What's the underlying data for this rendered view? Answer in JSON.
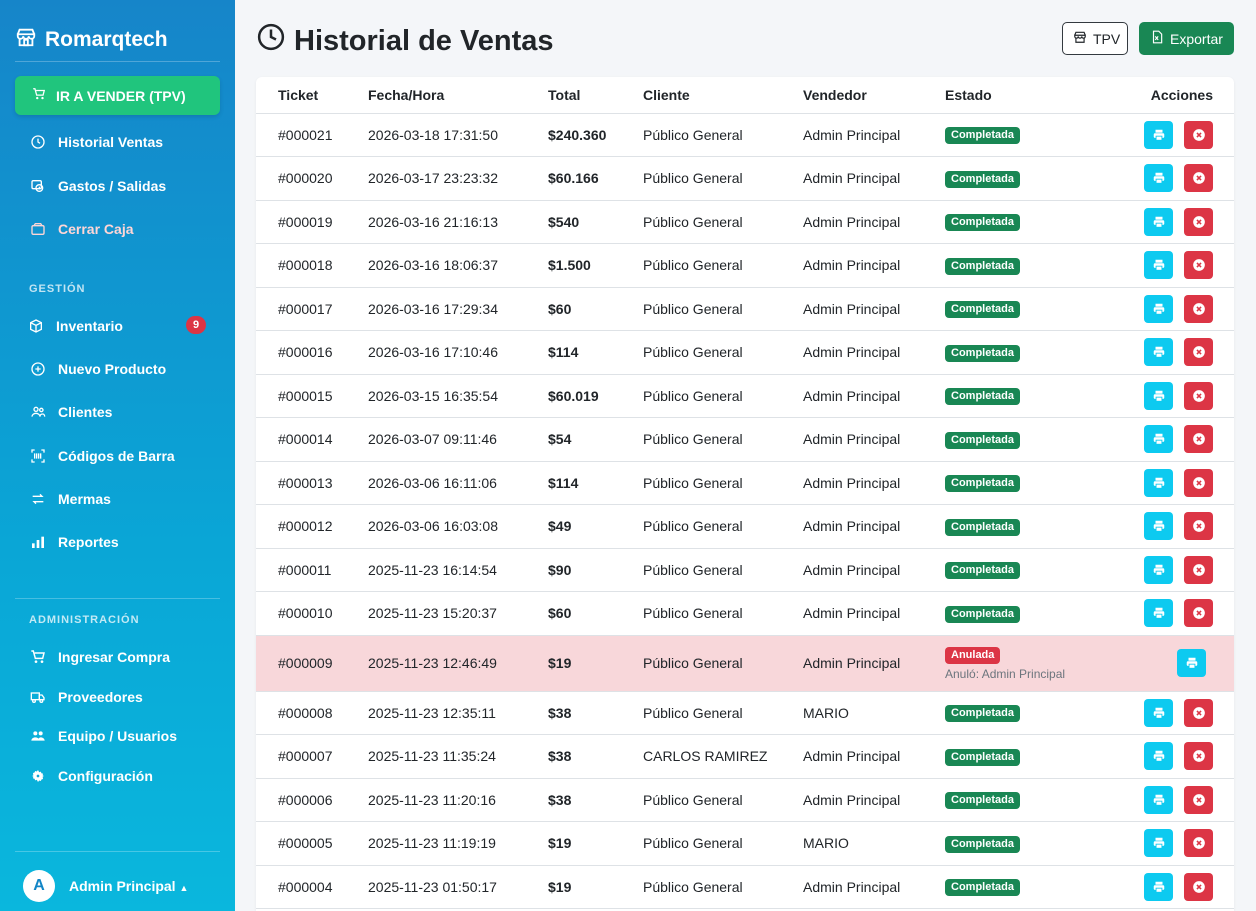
{
  "brand": {
    "name": "Romarqtech"
  },
  "sidebar": {
    "cta_label": "IR A VENDER (TPV)",
    "items_top": [
      {
        "label": "Historial Ventas",
        "icon": "clock-icon"
      },
      {
        "label": "Gastos / Salidas",
        "icon": "money-icon"
      },
      {
        "label": "Cerrar Caja",
        "icon": "box-icon"
      }
    ],
    "section_gestion": "GESTIÓN",
    "items_gestion": [
      {
        "label": "Inventario",
        "icon": "cube-icon",
        "badge": "9"
      },
      {
        "label": "Nuevo Producto",
        "icon": "plus-circle-icon"
      },
      {
        "label": "Clientes",
        "icon": "users-icon"
      },
      {
        "label": "Códigos de Barra",
        "icon": "barcode-icon"
      },
      {
        "label": "Mermas",
        "icon": "arrows-icon"
      },
      {
        "label": "Reportes",
        "icon": "bar-chart-icon"
      }
    ],
    "section_admin": "ADMINISTRACIÓN",
    "items_admin": [
      {
        "label": "Ingresar Compra",
        "icon": "cart-icon"
      },
      {
        "label": "Proveedores",
        "icon": "truck-icon"
      },
      {
        "label": "Equipo / Usuarios",
        "icon": "team-icon"
      },
      {
        "label": "Configuración",
        "icon": "gear-icon"
      }
    ],
    "user": {
      "initial": "A",
      "name": "Admin Principal"
    }
  },
  "header": {
    "title": "Historial de Ventas",
    "tpv_label": "TPV",
    "export_label": "Exportar"
  },
  "table": {
    "columns": [
      "Ticket",
      "Fecha/Hora",
      "Total",
      "Cliente",
      "Vendedor",
      "Estado",
      "Acciones"
    ],
    "rows": [
      {
        "ticket": "#000021",
        "fecha": "2026-03-18 17:31:50",
        "total": "$240.360",
        "cliente": "Público General",
        "vendedor": "Admin Principal",
        "estado": "Completada"
      },
      {
        "ticket": "#000020",
        "fecha": "2026-03-17 23:23:32",
        "total": "$60.166",
        "cliente": "Público General",
        "vendedor": "Admin Principal",
        "estado": "Completada"
      },
      {
        "ticket": "#000019",
        "fecha": "2026-03-16 21:16:13",
        "total": "$540",
        "cliente": "Público General",
        "vendedor": "Admin Principal",
        "estado": "Completada"
      },
      {
        "ticket": "#000018",
        "fecha": "2026-03-16 18:06:37",
        "total": "$1.500",
        "cliente": "Público General",
        "vendedor": "Admin Principal",
        "estado": "Completada"
      },
      {
        "ticket": "#000017",
        "fecha": "2026-03-16 17:29:34",
        "total": "$60",
        "cliente": "Público General",
        "vendedor": "Admin Principal",
        "estado": "Completada"
      },
      {
        "ticket": "#000016",
        "fecha": "2026-03-16 17:10:46",
        "total": "$114",
        "cliente": "Público General",
        "vendedor": "Admin Principal",
        "estado": "Completada"
      },
      {
        "ticket": "#000015",
        "fecha": "2026-03-15 16:35:54",
        "total": "$60.019",
        "cliente": "Público General",
        "vendedor": "Admin Principal",
        "estado": "Completada"
      },
      {
        "ticket": "#000014",
        "fecha": "2026-03-07 09:11:46",
        "total": "$54",
        "cliente": "Público General",
        "vendedor": "Admin Principal",
        "estado": "Completada"
      },
      {
        "ticket": "#000013",
        "fecha": "2026-03-06 16:11:06",
        "total": "$114",
        "cliente": "Público General",
        "vendedor": "Admin Principal",
        "estado": "Completada"
      },
      {
        "ticket": "#000012",
        "fecha": "2026-03-06 16:03:08",
        "total": "$49",
        "cliente": "Público General",
        "vendedor": "Admin Principal",
        "estado": "Completada"
      },
      {
        "ticket": "#000011",
        "fecha": "2025-11-23 16:14:54",
        "total": "$90",
        "cliente": "Público General",
        "vendedor": "Admin Principal",
        "estado": "Completada"
      },
      {
        "ticket": "#000010",
        "fecha": "2025-11-23 15:20:37",
        "total": "$60",
        "cliente": "Público General",
        "vendedor": "Admin Principal",
        "estado": "Completada"
      },
      {
        "ticket": "#000009",
        "fecha": "2025-11-23 12:46:49",
        "total": "$19",
        "cliente": "Público General",
        "vendedor": "Admin Principal",
        "estado": "Anulada",
        "anulo": "Anuló: Admin Principal"
      },
      {
        "ticket": "#000008",
        "fecha": "2025-11-23 12:35:11",
        "total": "$38",
        "cliente": "Público General",
        "vendedor": "MARIO",
        "estado": "Completada"
      },
      {
        "ticket": "#000007",
        "fecha": "2025-11-23 11:35:24",
        "total": "$38",
        "cliente": "CARLOS RAMIREZ",
        "vendedor": "Admin Principal",
        "estado": "Completada"
      },
      {
        "ticket": "#000006",
        "fecha": "2025-11-23 11:20:16",
        "total": "$38",
        "cliente": "Público General",
        "vendedor": "Admin Principal",
        "estado": "Completada"
      },
      {
        "ticket": "#000005",
        "fecha": "2025-11-23 11:19:19",
        "total": "$19",
        "cliente": "Público General",
        "vendedor": "MARIO",
        "estado": "Completada"
      },
      {
        "ticket": "#000004",
        "fecha": "2025-11-23 01:50:17",
        "total": "$19",
        "cliente": "Público General",
        "vendedor": "Admin Principal",
        "estado": "Completada"
      }
    ]
  },
  "colors": {
    "sidebar_top": "#1685c9",
    "sidebar_bottom": "#0ab7dd",
    "cta": "#20c57d",
    "success": "#198754",
    "danger": "#dc3545",
    "info": "#0dcaf0"
  }
}
